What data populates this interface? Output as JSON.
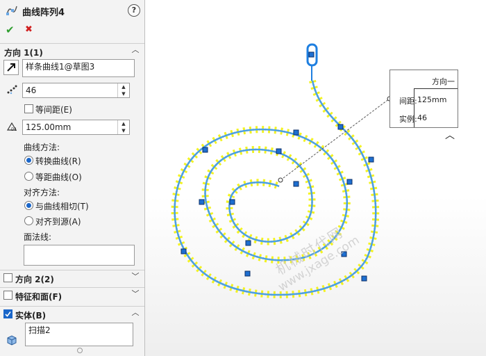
{
  "header": {
    "title": "曲线阵列4",
    "help_icon": "?"
  },
  "actions": {
    "ok": "✔",
    "cancel": "✖"
  },
  "direction1": {
    "title": "方向 1(1)",
    "curve_value": "样条曲线1@草图3",
    "count_value": "46",
    "equal_spacing_label": "等间距(E)",
    "spacing_value": "125.00mm",
    "curve_method_label": "曲线方法:",
    "curve_method_options": [
      "转换曲线(R)",
      "等距曲线(O)"
    ],
    "align_method_label": "对齐方法:",
    "align_method_options": [
      "与曲线相切(T)",
      "对齐到源(A)"
    ],
    "normal_label": "面法线:"
  },
  "direction2": {
    "title": "方向 2(2)"
  },
  "features": {
    "title": "特征和面(F)"
  },
  "bodies": {
    "title": "实体(B)",
    "value": "扫描2"
  },
  "callout": {
    "title": "方向一",
    "spacing_label": "间距:",
    "spacing_value": "125mm",
    "instance_label": "实例:",
    "instance_value": "46"
  },
  "watermark": {
    "line1": "机械时代网",
    "line2": "www.jxage.com"
  },
  "colors": {
    "accent": "#1a66c9",
    "curve": "#4a9fe6",
    "instance": "#f2f20a",
    "ok": "#2e9d2e",
    "cancel": "#d01f1f"
  }
}
